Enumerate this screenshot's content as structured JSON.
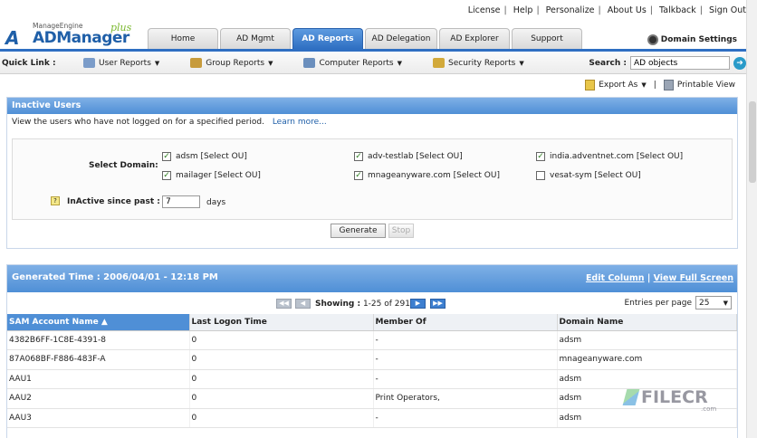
{
  "top_links": [
    "License",
    "Help",
    "Personalize",
    "About Us",
    "Talkback",
    "Sign Out"
  ],
  "logo": {
    "brand": "ManageEngine",
    "product": "ADManager",
    "edition": "plus",
    "icon_letters": "A"
  },
  "tabs": [
    "Home",
    "AD Mgmt",
    "AD Reports",
    "AD Delegation",
    "AD Explorer",
    "Support"
  ],
  "active_tab": "AD Reports",
  "domain_settings_label": "Domain Settings",
  "quick_link": {
    "label": "Quick Link :",
    "items": [
      "User Reports",
      "Group Reports",
      "Computer Reports",
      "Security Reports"
    ]
  },
  "search": {
    "label": "Search :",
    "value": "AD objects"
  },
  "export": {
    "export_label": "Export As",
    "printable_label": "Printable View"
  },
  "report": {
    "title": "Inactive Users",
    "description": "View the users who have not logged on for a specified period.",
    "learn_more": "Learn more...",
    "select_domain_label": "Select Domain:",
    "domains": [
      {
        "label": "adsm [Select OU]",
        "checked": true
      },
      {
        "label": "adv-testlab [Select OU]",
        "checked": true
      },
      {
        "label": "india.adventnet.com [Select OU]",
        "checked": true
      },
      {
        "label": "mailager [Select OU]",
        "checked": true
      },
      {
        "label": "mnageanyware.com [Select OU]",
        "checked": true
      },
      {
        "label": "vesat-sym [Select OU]",
        "checked": false
      }
    ],
    "inactive_label": "InActive since past :",
    "inactive_value": "7",
    "days_label": "days",
    "generate_label": "Generate",
    "stop_label": "Stop"
  },
  "results": {
    "generated": "Generated Time : 2006/04/01 - 12:18 PM",
    "edit_column": "Edit Column",
    "view_full": "View Full Screen",
    "showing_label": "Showing :",
    "showing_range": "1-25 of 291",
    "entries_label": "Entries per page",
    "entries_value": "25",
    "columns": [
      "SAM Account Name ▲",
      "Last Logon Time",
      "Member Of",
      "Domain Name"
    ],
    "rows": [
      [
        "4382B6FF-1C8E-4391-8",
        "0",
        "-",
        "adsm"
      ],
      [
        "87A068BF-F886-483F-A",
        "0",
        "-",
        "mnageanyware.com"
      ],
      [
        "AAU1",
        "0",
        "-",
        "adsm"
      ],
      [
        "AAU2",
        "0",
        "Print Operators,",
        "adsm"
      ],
      [
        "AAU3",
        "0",
        "-",
        "adsm"
      ]
    ]
  },
  "watermark": {
    "text": "FILECR",
    "sub": ".com"
  }
}
